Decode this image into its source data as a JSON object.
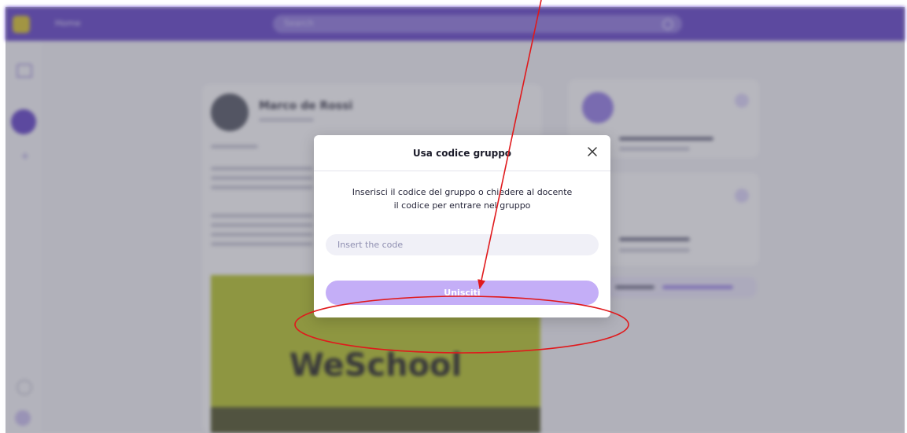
{
  "app": {
    "breadcrumb": "Home",
    "search_placeholder": "Search",
    "brand": "WeSchool",
    "post_author": "Marco de Rossi",
    "colors": {
      "topbar": "#5a38c6",
      "accent": "#c4aef7",
      "banner": "#b5c41c",
      "annotation": "#e0191c"
    }
  },
  "modal": {
    "title": "Usa codice gruppo",
    "description_line1": "Inserisci il codice del gruppo o chiedere al docente",
    "description_line2": "il codice per entrare nel gruppo",
    "input_placeholder": "Insert the code",
    "input_value": "",
    "join_label": "Unisciti",
    "close_icon": "close-icon"
  },
  "annotation": {
    "shapes": [
      "red-arrow",
      "red-ellipse"
    ]
  }
}
